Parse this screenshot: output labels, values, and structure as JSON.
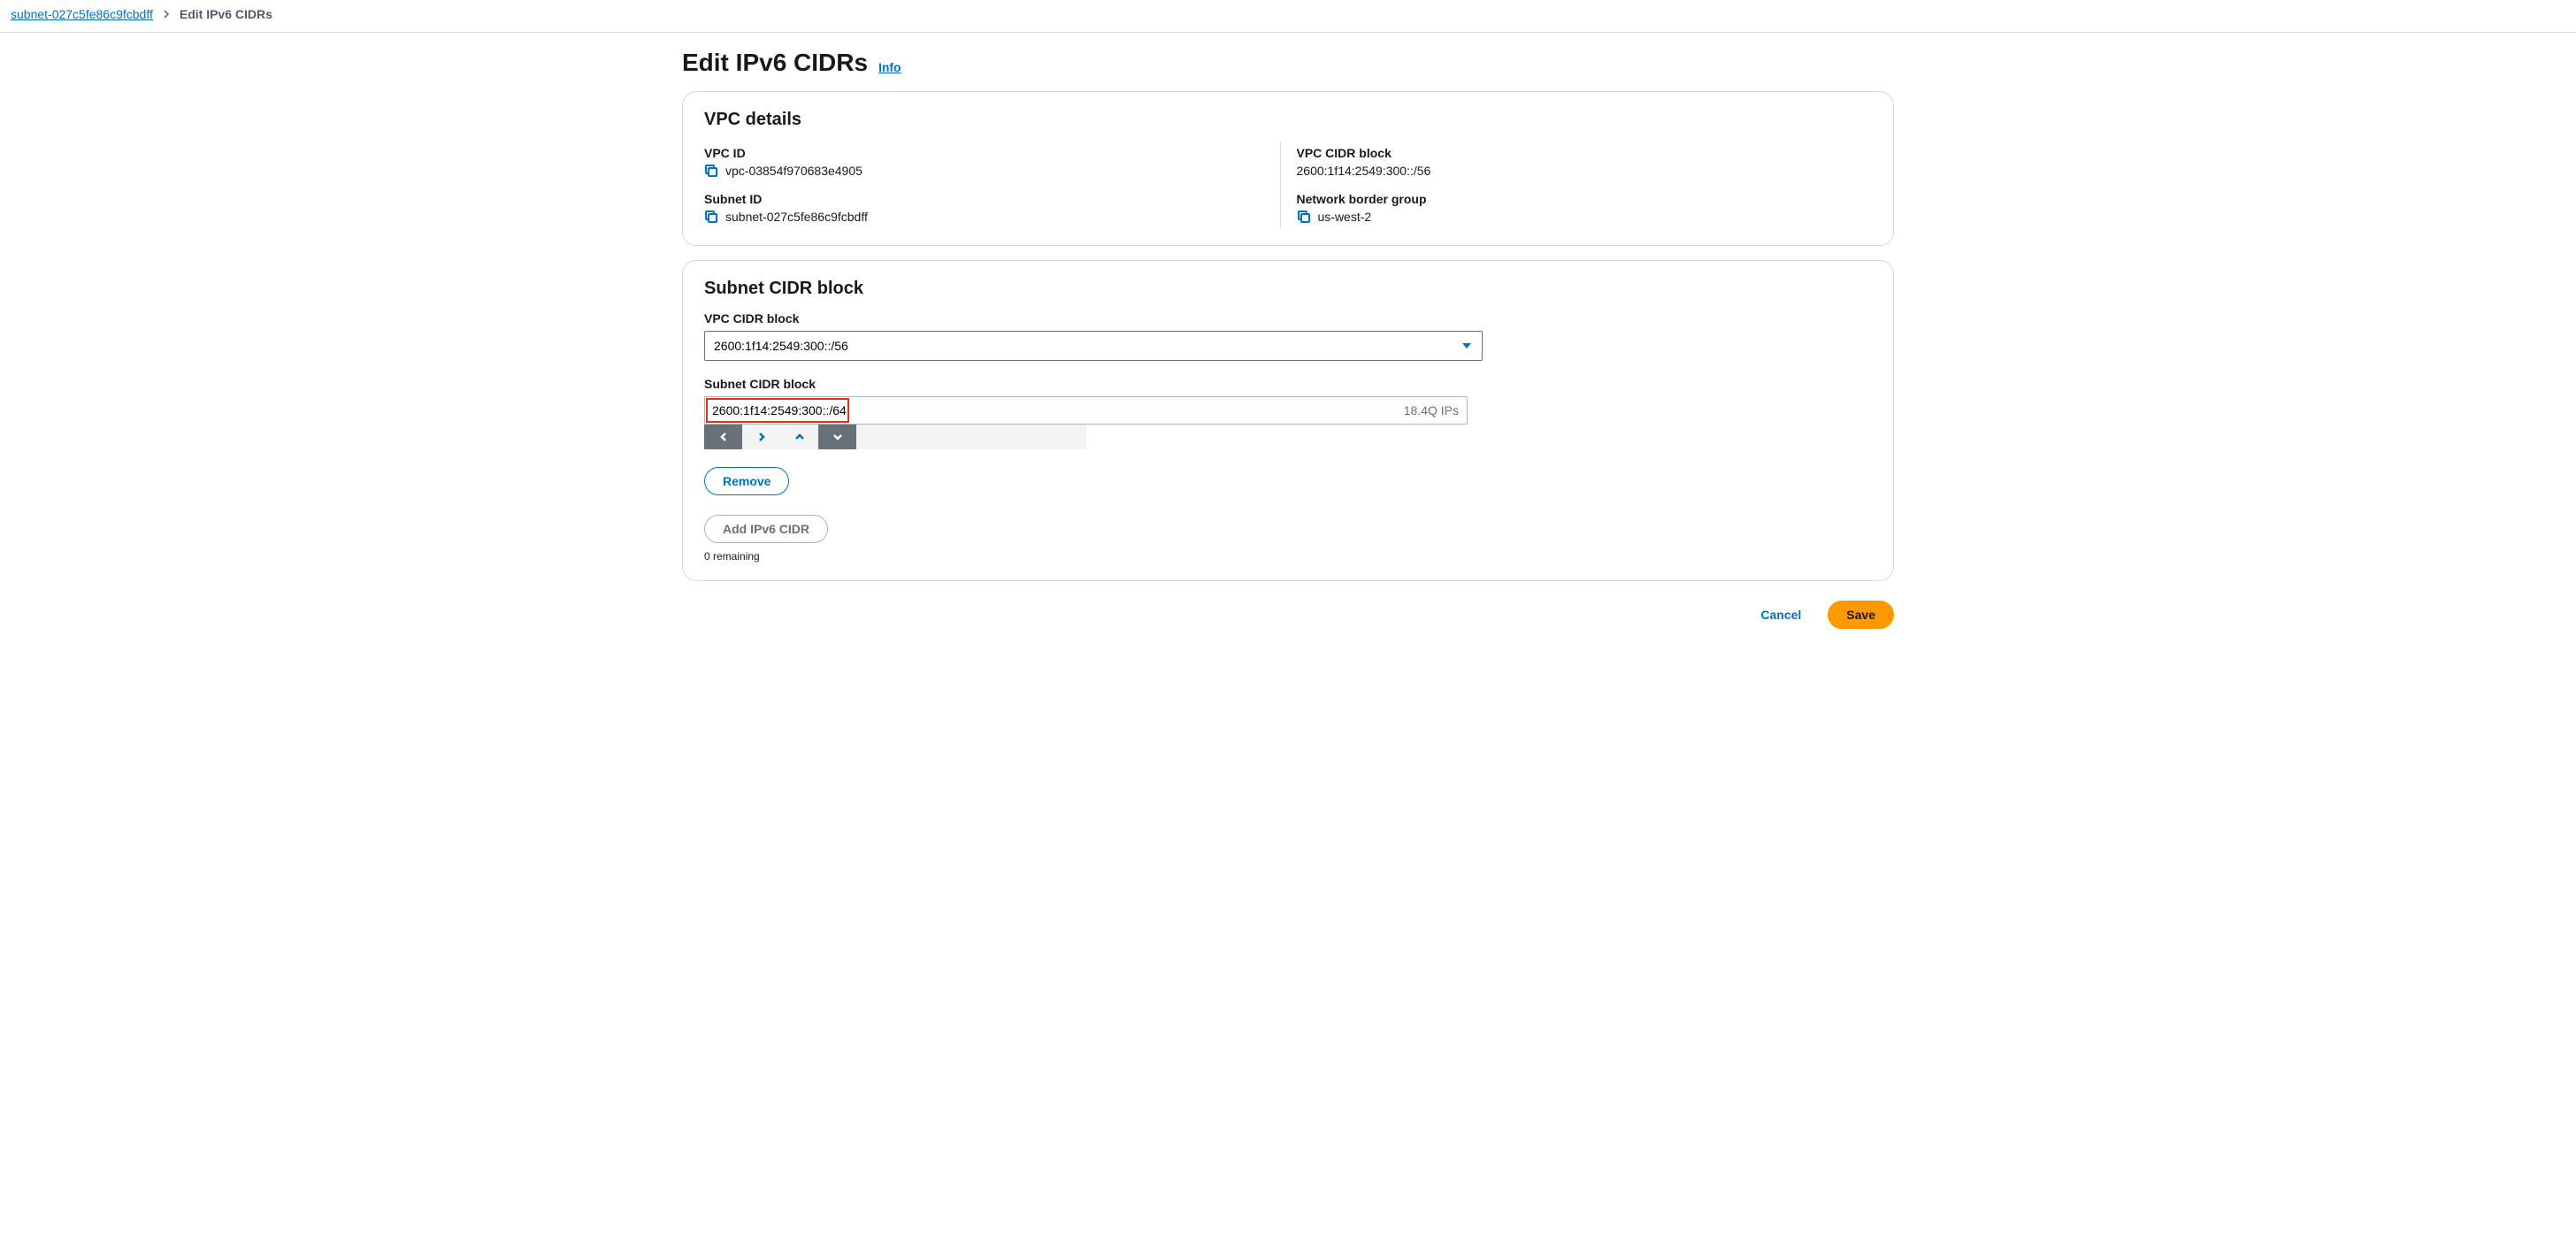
{
  "breadcrumb": {
    "subnet_link": "subnet-027c5fe86c9fcbdff",
    "current": "Edit IPv6 CIDRs"
  },
  "page_title": "Edit IPv6 CIDRs",
  "info_label": "Info",
  "vpc_panel": {
    "heading": "VPC details",
    "vpc_id_label": "VPC ID",
    "vpc_id": "vpc-03854f970683e4905",
    "subnet_id_label": "Subnet ID",
    "subnet_id": "subnet-027c5fe86c9fcbdff",
    "vpc_cidr_label": "VPC CIDR block",
    "vpc_cidr": "2600:1f14:2549:300::/56",
    "nbg_label": "Network border group",
    "nbg": "us-west-2"
  },
  "subnet_panel": {
    "heading": "Subnet CIDR block",
    "vpc_cidr_label": "VPC CIDR block",
    "vpc_cidr_selected": "2600:1f14:2549:300::/56",
    "subnet_cidr_label": "Subnet CIDR block",
    "subnet_cidr_value": "2600:1f14:2549:300::/64",
    "ip_count": "18.4Q IPs",
    "remove_label": "Remove",
    "add_label": "Add IPv6 CIDR",
    "remaining": "0 remaining"
  },
  "footer": {
    "cancel": "Cancel",
    "save": "Save"
  }
}
